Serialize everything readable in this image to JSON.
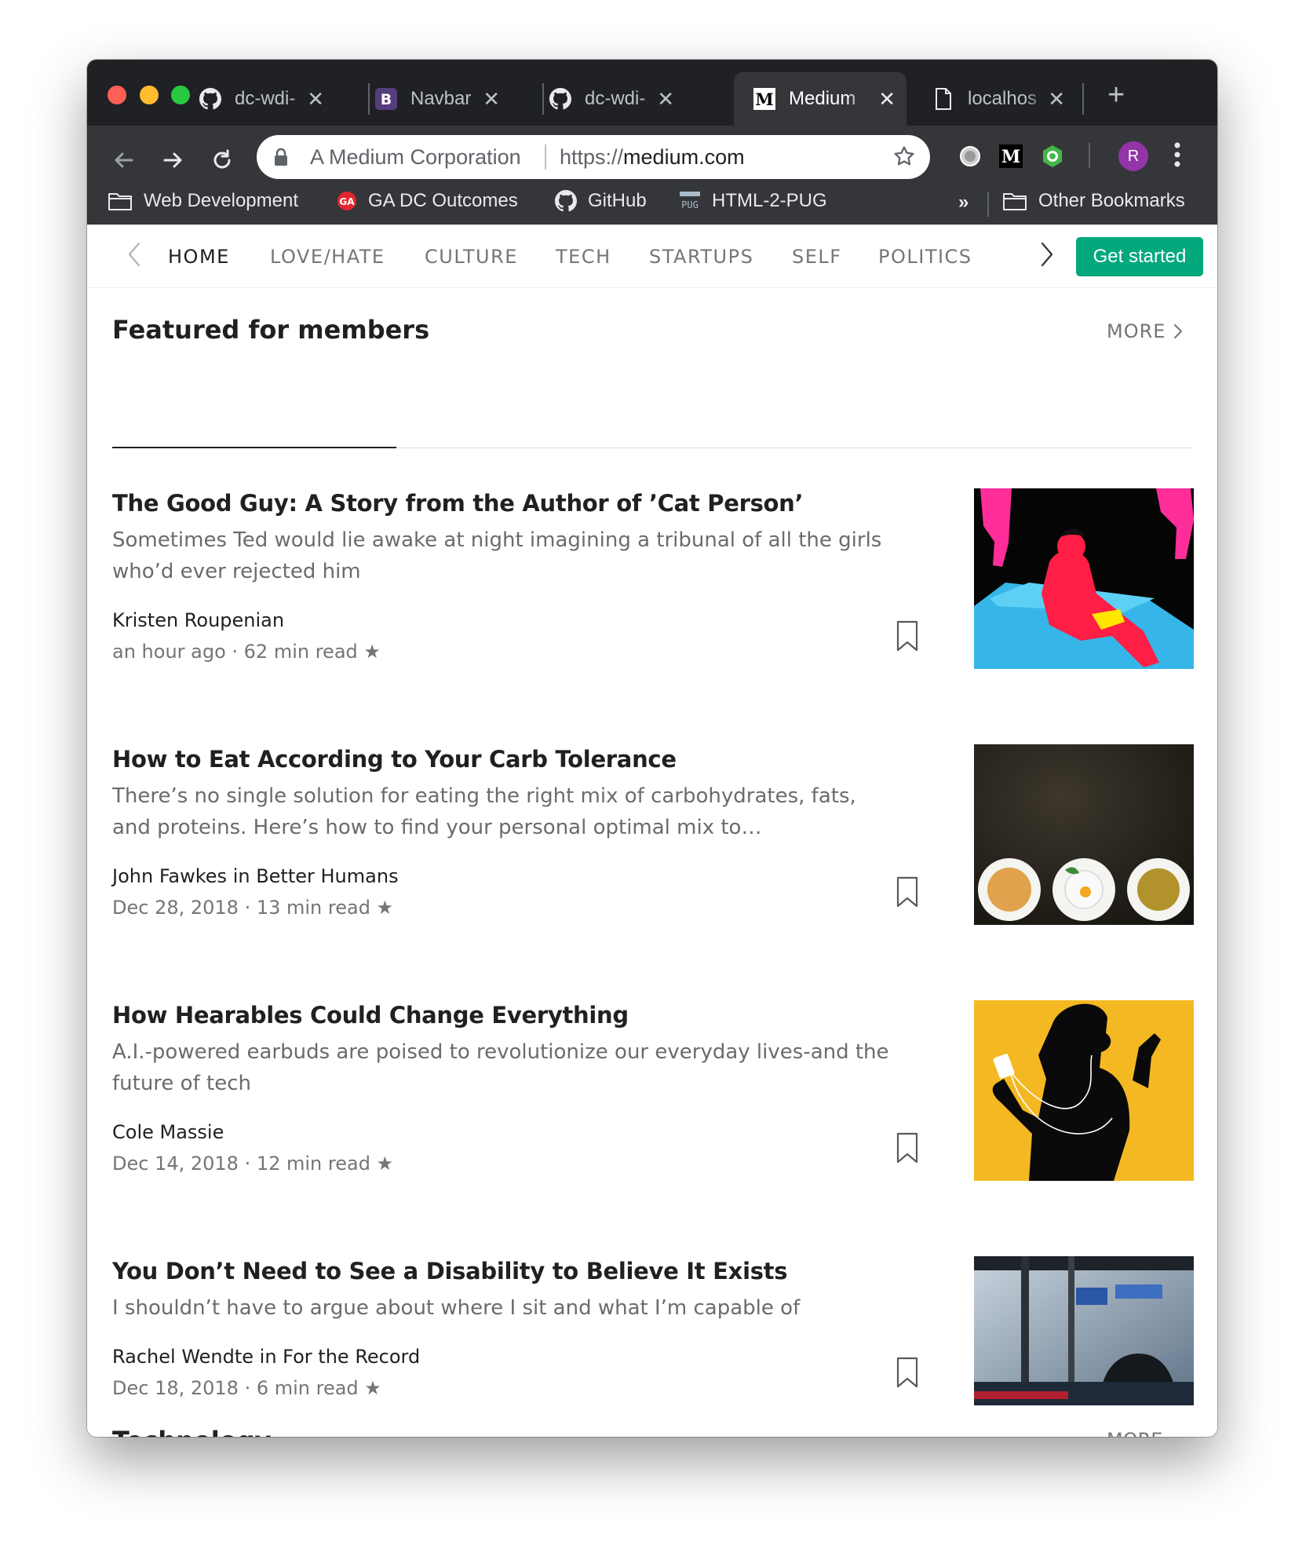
{
  "browser": {
    "tabs": [
      {
        "title": "dc-wdi-",
        "icon": "github-icon",
        "active": false
      },
      {
        "title": "Navbar",
        "icon": "bootstrap-icon",
        "active": false
      },
      {
        "title": "dc-wdi-",
        "icon": "github-icon",
        "active": false
      },
      {
        "title": "Medium",
        "icon": "medium-icon",
        "active": true
      },
      {
        "title": "localhos",
        "icon": "document-icon",
        "active": false
      }
    ],
    "omnibox": {
      "org": "A Medium Corporation",
      "url_scheme": "https://",
      "url_host": "medium.com"
    },
    "avatar_initial": "R",
    "bookmarks": [
      {
        "label": "Web Development",
        "icon": "folder-icon"
      },
      {
        "label": "GA DC Outcomes",
        "icon": "ga-icon"
      },
      {
        "label": "GitHub",
        "icon": "github-icon"
      },
      {
        "label": "HTML-2-PUG",
        "icon": "pug-icon"
      }
    ],
    "bookmarks_overflow": "»",
    "other_bookmarks": "Other Bookmarks"
  },
  "nav": {
    "items": [
      "HOME",
      "LOVE/HATE",
      "CULTURE",
      "TECH",
      "STARTUPS",
      "SELF",
      "POLITICS"
    ],
    "active_index": 0,
    "cta": "Get started"
  },
  "section": {
    "title": "Featured for members",
    "more": "MORE"
  },
  "posts": [
    {
      "title": "The Good Guy: A Story from the Author of ’Cat Person’",
      "subtitle": "Sometimes Ted would lie awake at night imagining a tribunal of all the girls who’d ever rejected him",
      "author": "Kristen Roupenian",
      "meta": "an hour ago · 62 min read ★"
    },
    {
      "title": "How to Eat According to Your Carb Tolerance",
      "subtitle": "There’s no single solution for eating the right mix of carbohydrates, fats, and proteins. Here’s how to find your personal optimal mix to…",
      "author": "John Fawkes in Better Humans",
      "meta": "Dec 28, 2018 · 13 min read ★"
    },
    {
      "title": "How Hearables Could Change Everything",
      "subtitle": "A.I.-powered earbuds are poised to revolutionize our everyday lives-and the future of tech",
      "author": "Cole Massie",
      "meta": "Dec 14, 2018 · 12 min read ★"
    },
    {
      "title": "You Don’t Need to See a Disability to Believe It Exists",
      "subtitle": "I shouldn’t have to argue about where I sit and what I’m capable of",
      "author": "Rachel Wendte in For the Record",
      "meta": "Dec 18, 2018 · 6 min read ★"
    }
  ],
  "next_section": {
    "title": "Technology",
    "more": "MORE"
  },
  "colors": {
    "accent": "#03a87c",
    "chrome_dark": "#202124",
    "chrome_toolbar": "#35363a"
  }
}
